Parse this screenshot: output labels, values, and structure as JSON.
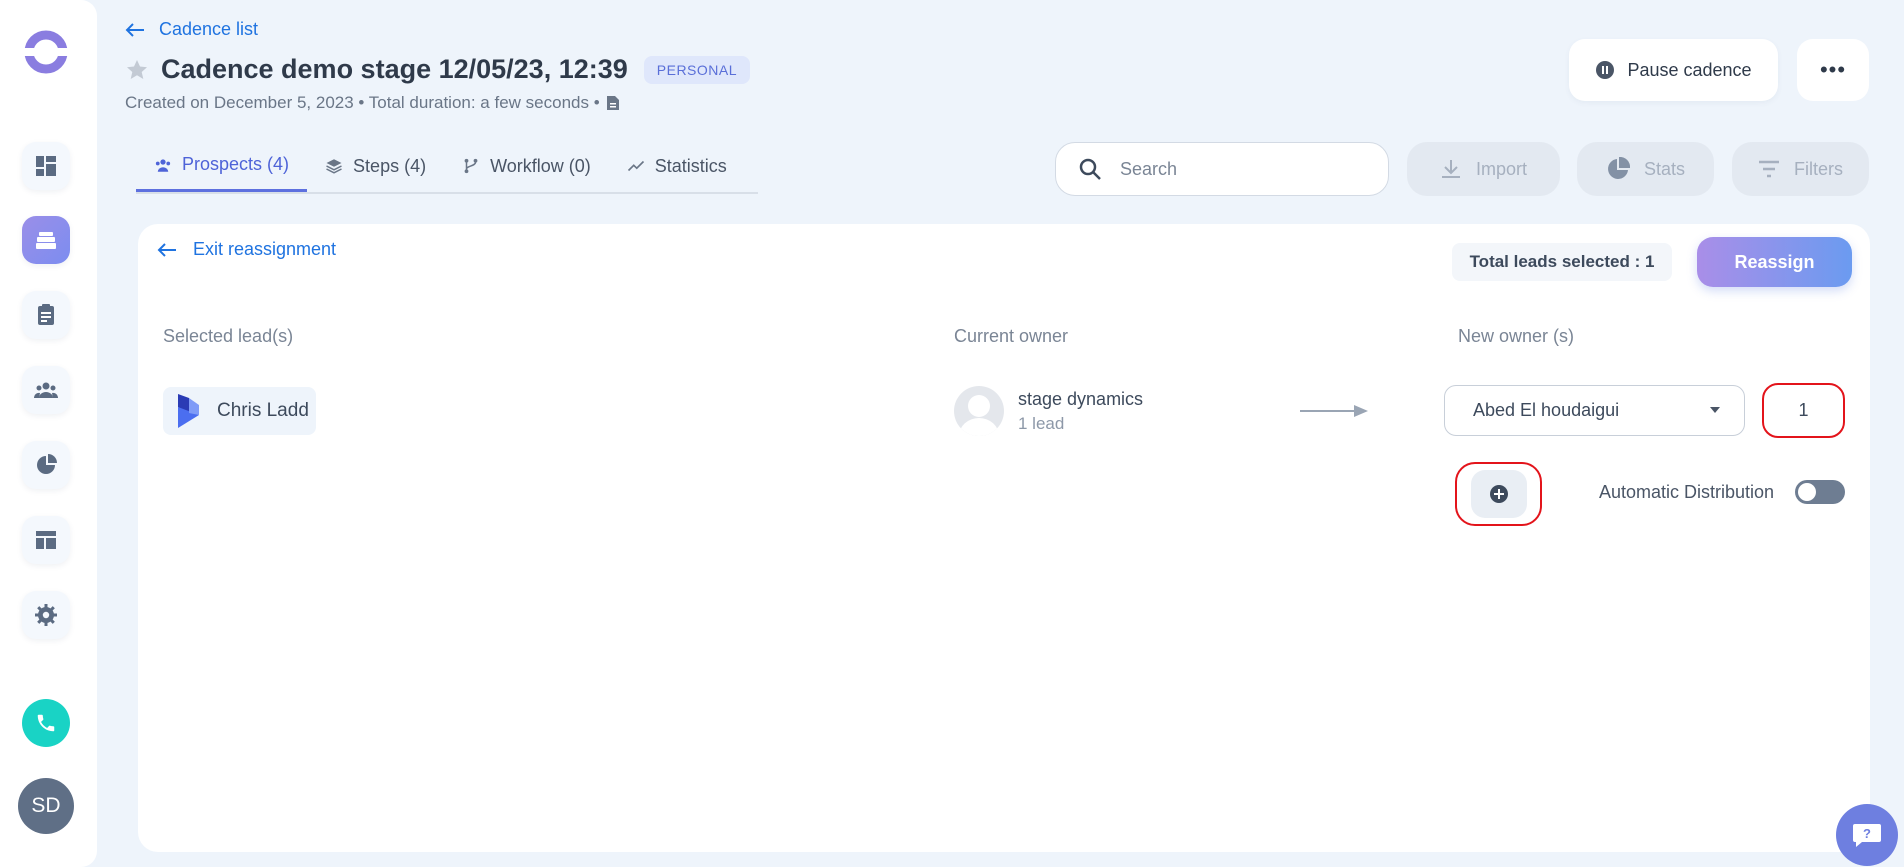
{
  "header": {
    "back_label": "Cadence list",
    "title": "Cadence demo stage 12/05/23, 12:39",
    "badge": "PERSONAL",
    "subtitle": "Created on December 5, 2023 • Total duration: a few seconds •",
    "pause_label": "Pause cadence",
    "more_label": "•••"
  },
  "tabs": [
    {
      "label": "Prospects (4)",
      "icon": "prospects-icon"
    },
    {
      "label": "Steps (4)",
      "icon": "layers-icon"
    },
    {
      "label": "Workflow (0)",
      "icon": "workflow-icon"
    },
    {
      "label": "Statistics",
      "icon": "trend-icon"
    }
  ],
  "toolbar": {
    "search_placeholder": "Search",
    "import_label": "Import",
    "stats_label": "Stats",
    "filters_label": "Filters"
  },
  "reassign": {
    "exit_label": "Exit reassignment",
    "total_label": "Total leads selected : 1",
    "reassign_label": "Reassign",
    "col_selected": "Selected lead(s)",
    "col_current": "Current owner",
    "col_new": "New owner (s)",
    "lead_name": "Chris Ladd",
    "owner_name": "stage dynamics",
    "owner_count": "1 lead",
    "new_owner": "Abed El houdaigui",
    "quantity": "1",
    "auto_dist_label": "Automatic Distribution",
    "auto_dist_on": false
  },
  "user": {
    "initials": "SD"
  },
  "colors": {
    "accent": "#1f73e0",
    "highlight": "#e3141b",
    "phone": "#19d3c5"
  }
}
